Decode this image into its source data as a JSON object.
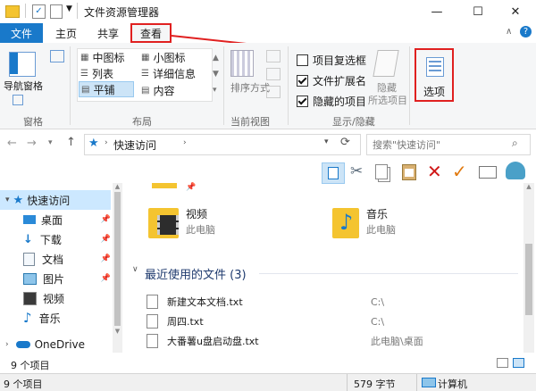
{
  "window": {
    "title": "文件资源管理器",
    "controls": {
      "minimize": "—",
      "maximize": "☐",
      "close": "✕"
    }
  },
  "tabs": [
    {
      "label": "文件",
      "active": true
    },
    {
      "label": "主页"
    },
    {
      "label": "共享"
    },
    {
      "label": "查看",
      "highlighted": true
    }
  ],
  "ribbon": {
    "pane": {
      "nav_pane": "导航窗格",
      "group": "窗格"
    },
    "layout": {
      "items": [
        "中图标",
        "小图标",
        "列表",
        "详细信息",
        "平铺",
        "内容"
      ],
      "selected": "平铺",
      "group": "布局"
    },
    "current_view": {
      "sort": "排序方式",
      "group": "当前视图"
    },
    "show_hide": {
      "item_checkbox": "项目复选框",
      "item_checkbox_checked": false,
      "file_ext": "文件扩展名",
      "file_ext_checked": true,
      "hidden_items": "隐藏的项目",
      "hidden_items_checked": true,
      "hide": "隐藏",
      "hide_selected": "所选项目",
      "group": "显示/隐藏"
    },
    "options": {
      "label": "选项"
    }
  },
  "address": {
    "path": "快速访问",
    "search_placeholder": "搜索\"快速访问\""
  },
  "toolbar_icons": [
    "details-pane-icon",
    "cut-icon",
    "copy-icon",
    "paste-icon",
    "delete-icon",
    "check-icon",
    "rename-icon",
    "extra-icon"
  ],
  "sidebar": {
    "quick_access": "快速访问",
    "items": [
      {
        "label": "桌面",
        "pinned": true
      },
      {
        "label": "下载",
        "pinned": true
      },
      {
        "label": "文档",
        "pinned": true
      },
      {
        "label": "图片",
        "pinned": true
      },
      {
        "label": "视频",
        "pinned": false
      },
      {
        "label": "音乐",
        "pinned": false
      }
    ],
    "onedrive": "OneDrive"
  },
  "main": {
    "tiles": [
      {
        "name": "视频",
        "location": "此电脑"
      },
      {
        "name": "音乐",
        "location": "此电脑"
      }
    ],
    "recent_header": "最近使用的文件 (3)",
    "recent_files": [
      {
        "name": "新建文本文档.txt",
        "path": "C:\\"
      },
      {
        "name": "周四.txt",
        "path": "C:\\"
      },
      {
        "name": "大番薯u盘启动盘.txt",
        "path": "此电脑\\桌面"
      }
    ]
  },
  "status": {
    "count": "9 个项目",
    "bottom_count": "9 个项目",
    "size": "579 字节",
    "computer": "计算机"
  },
  "colors": {
    "accent": "#1979ca",
    "highlight": "#e02020",
    "folder": "#f4c430"
  }
}
